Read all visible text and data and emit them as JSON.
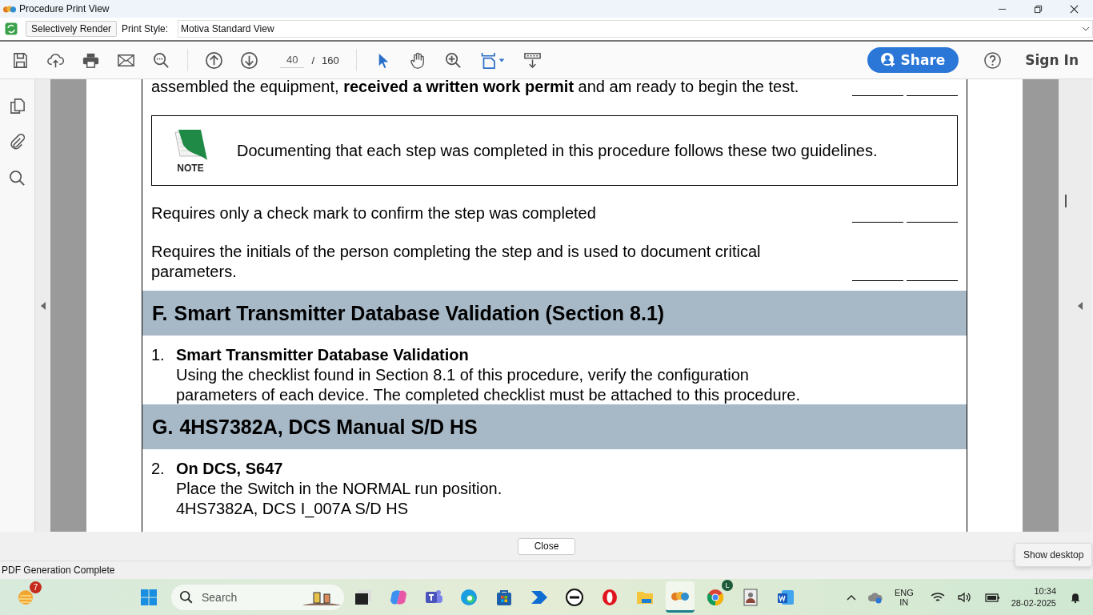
{
  "window": {
    "title": "Procedure Print View"
  },
  "render_bar": {
    "button": "Selectively Render",
    "print_style_label": "Print Style:",
    "print_style_value": "Motiva Standard View"
  },
  "toolbar": {
    "page_current": "40",
    "page_separator": "/",
    "page_total": "160",
    "share": "Share",
    "sign_in": "Sign In"
  },
  "document": {
    "blocks": [
      {
        "kind": "para",
        "text": "assembled the equipment, **received a written work permit** and am ready to begin the test.",
        "signoff": true
      },
      {
        "kind": "note",
        "label": "NOTE",
        "text": "Documenting that each step was completed in this procedure follows these two guidelines."
      },
      {
        "kind": "para",
        "text": "Requires only a check mark to confirm the step was completed",
        "signoff": true
      },
      {
        "kind": "para",
        "text": "Requires the initials of the person completing the step and is used to document critical parameters.",
        "signoff": true
      },
      {
        "kind": "section",
        "letter": "F.",
        "title": "Smart Transmitter Database Validation (Section 8.1)"
      },
      {
        "kind": "step",
        "number": "1.",
        "title": "Smart Transmitter Database Validation",
        "lines": [
          "Using the checklist found in Section 8.1 of this procedure, verify the configuration",
          "parameters of each device. The completed checklist must be attached to this procedure."
        ]
      },
      {
        "kind": "section",
        "letter": "G.",
        "title": "4HS7382A, DCS Manual S/D HS"
      },
      {
        "kind": "step",
        "number": "2.",
        "title": "On DCS, S647",
        "lines": [
          "Place the Switch in the NORMAL run position.",
          "4HS7382A, DCS I_007A S/D HS"
        ]
      }
    ]
  },
  "close_button": "Close",
  "status_bar": "PDF Generation Complete",
  "tooltip": "Show desktop",
  "taskbar": {
    "weather_badge": "7",
    "search_placeholder": "Search",
    "chrome_badge": "L",
    "language": [
      "ENG",
      "IN"
    ],
    "time": "10:34",
    "date": "28-02-2025"
  }
}
